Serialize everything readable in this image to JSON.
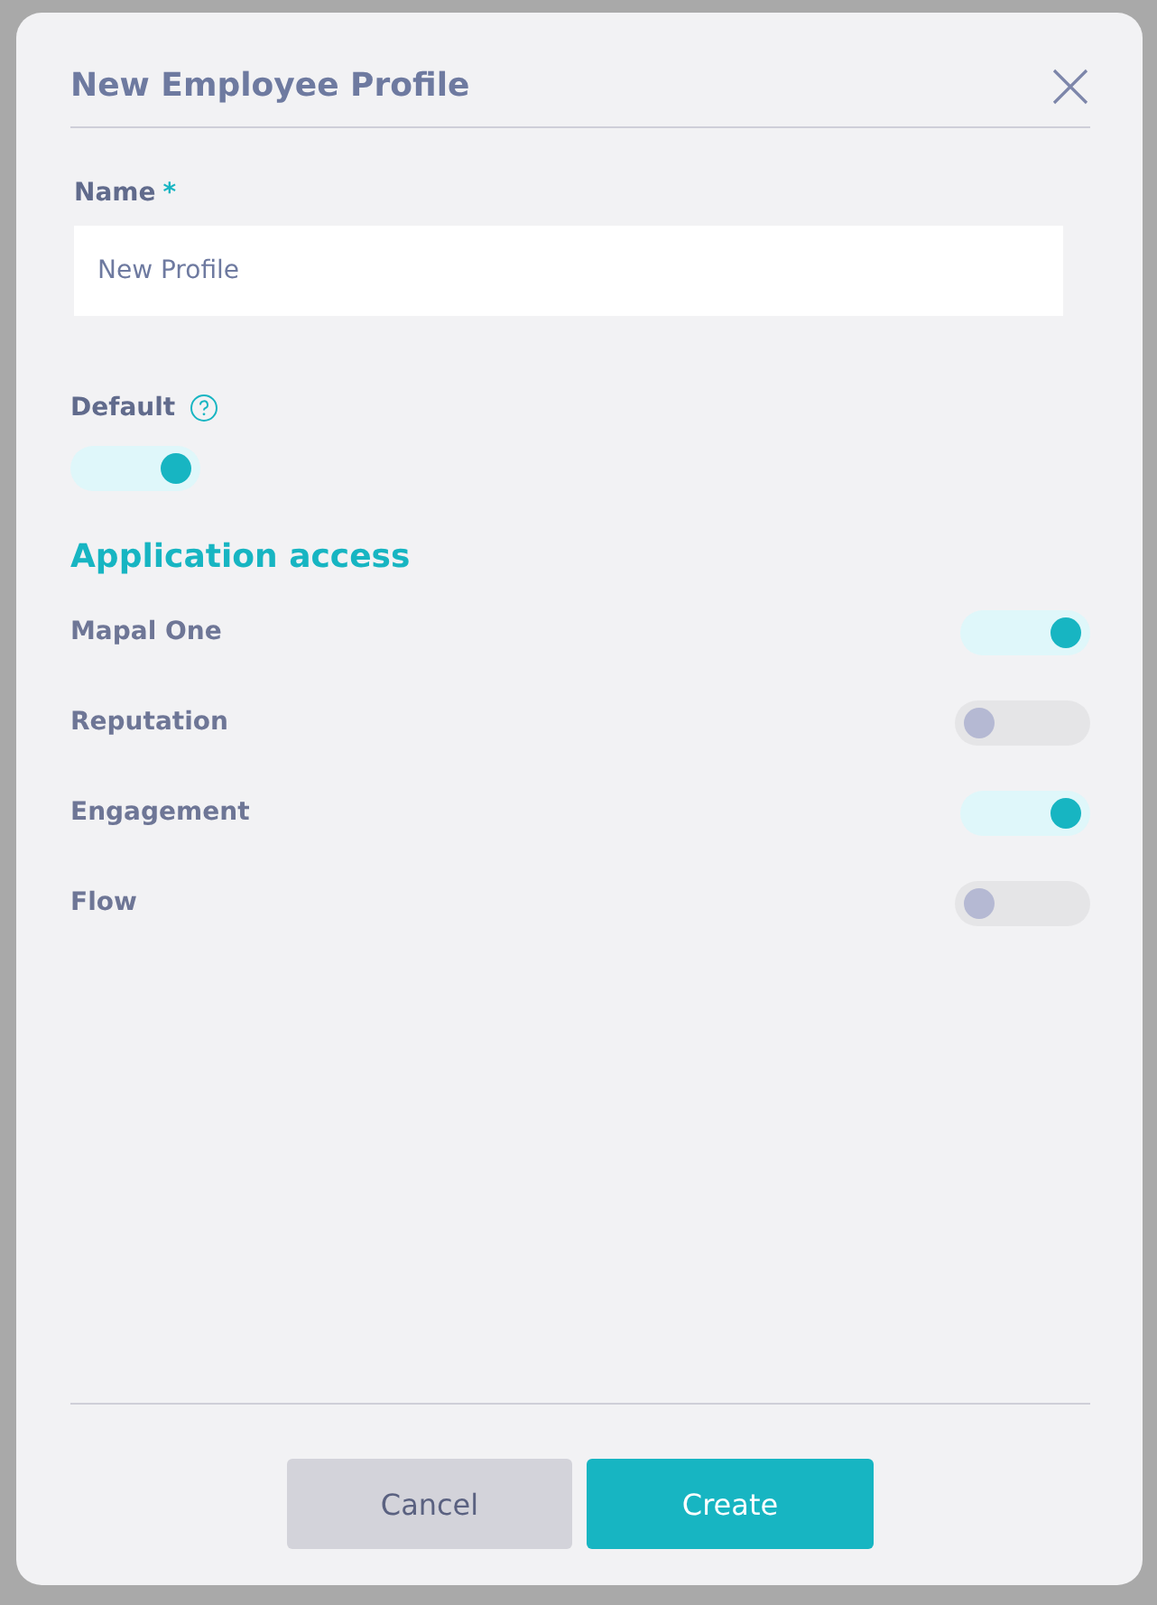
{
  "dialog": {
    "title": "New Employee Profile",
    "name_field": {
      "label": "Name",
      "required_mark": "*",
      "value": "New Profile"
    },
    "default": {
      "label": "Default",
      "on": true
    },
    "section_title": "Application access",
    "apps": [
      {
        "label": "Mapal One",
        "on": true
      },
      {
        "label": "Reputation",
        "on": false
      },
      {
        "label": "Engagement",
        "on": true
      },
      {
        "label": "Flow",
        "on": false
      }
    ],
    "buttons": [
      {
        "label": "Cancel",
        "kind": "secondary"
      },
      {
        "label": "Create",
        "kind": "primary"
      }
    ]
  }
}
